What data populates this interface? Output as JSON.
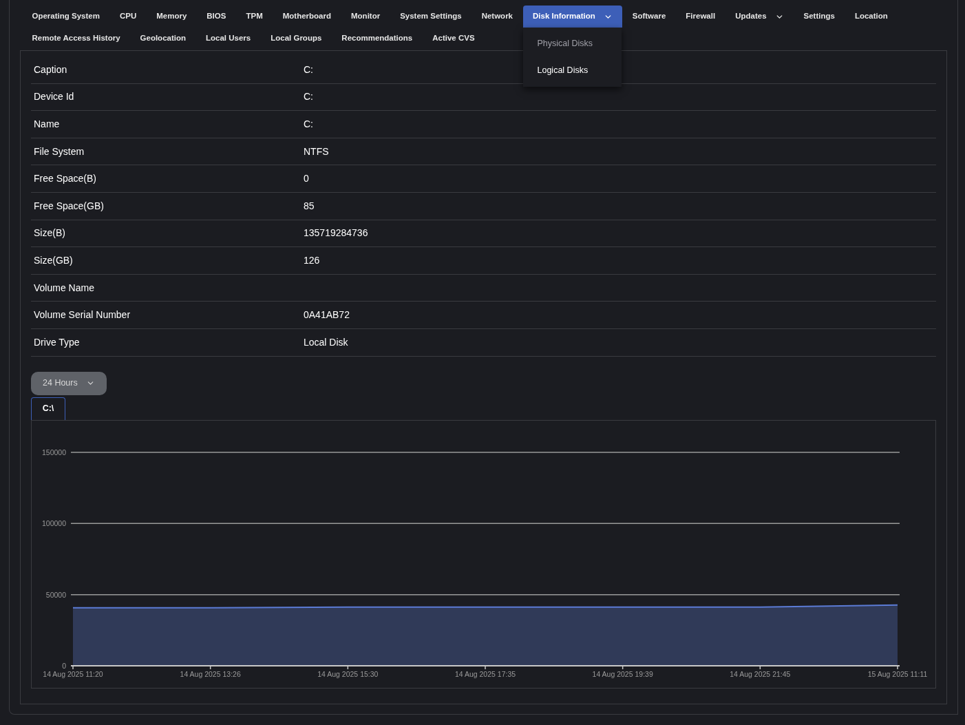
{
  "nav_tabs": [
    {
      "label": "Operating System",
      "selected": false,
      "has_menu": false
    },
    {
      "label": "CPU",
      "selected": false,
      "has_menu": false
    },
    {
      "label": "Memory",
      "selected": false,
      "has_menu": false
    },
    {
      "label": "BIOS",
      "selected": false,
      "has_menu": false
    },
    {
      "label": "TPM",
      "selected": false,
      "has_menu": false
    },
    {
      "label": "Motherboard",
      "selected": false,
      "has_menu": false
    },
    {
      "label": "Monitor",
      "selected": false,
      "has_menu": false
    },
    {
      "label": "System Settings",
      "selected": false,
      "has_menu": false
    },
    {
      "label": "Network",
      "selected": false,
      "has_menu": false
    },
    {
      "label": "Disk Information",
      "selected": true,
      "has_menu": true
    },
    {
      "label": "Software",
      "selected": false,
      "has_menu": false
    },
    {
      "label": "Firewall",
      "selected": false,
      "has_menu": false
    },
    {
      "label": "Updates",
      "selected": false,
      "has_menu": true
    },
    {
      "label": "Settings",
      "selected": false,
      "has_menu": false
    },
    {
      "label": "Location",
      "selected": false,
      "has_menu": false
    },
    {
      "label": "Remote Access History",
      "selected": false,
      "has_menu": false
    },
    {
      "label": "Geolocation",
      "selected": false,
      "has_menu": false
    },
    {
      "label": "Local Users",
      "selected": false,
      "has_menu": false
    },
    {
      "label": "Local Groups",
      "selected": false,
      "has_menu": false
    },
    {
      "label": "Recommendations",
      "selected": false,
      "has_menu": false
    },
    {
      "label": "Active CVS",
      "selected": false,
      "has_menu": false
    }
  ],
  "dropdown_menu": [
    {
      "label": "Physical Disks",
      "selected": false
    },
    {
      "label": "Logical Disks",
      "selected": true
    }
  ],
  "properties": [
    {
      "label": "Caption",
      "value": "C:"
    },
    {
      "label": "Device Id",
      "value": "C:"
    },
    {
      "label": "Name",
      "value": "C:"
    },
    {
      "label": "File System",
      "value": "NTFS"
    },
    {
      "label": "Free Space(B)",
      "value": "0"
    },
    {
      "label": "Free Space(GB)",
      "value": "85"
    },
    {
      "label": "Size(B)",
      "value": "135719284736"
    },
    {
      "label": "Size(GB)",
      "value": "126"
    },
    {
      "label": "Volume Name"
    },
    {
      "label": "Volume Serial Number",
      "value": "0A41AB72"
    },
    {
      "label": "Drive Type",
      "value": "Local Disk"
    }
  ],
  "range_select": {
    "value": "24 Hours"
  },
  "drive_tabs": [
    {
      "label": "C:\\",
      "selected": true
    }
  ],
  "chart_data": {
    "type": "area",
    "categories": [
      "14 Aug 2025 11:20",
      "14 Aug 2025 13:26",
      "14 Aug 2025 15:30",
      "14 Aug 2025 17:35",
      "14 Aug 2025 19:39",
      "14 Aug 2025 21:45",
      "15 Aug 2025 11:11"
    ],
    "series": [
      {
        "color": "#5b7bd5",
        "values": [
          40800,
          40800,
          41300,
          41300,
          41300,
          41300,
          42700
        ]
      }
    ],
    "ylim": [
      0,
      150000
    ],
    "yticks": [
      0,
      50000,
      100000,
      150000
    ]
  }
}
